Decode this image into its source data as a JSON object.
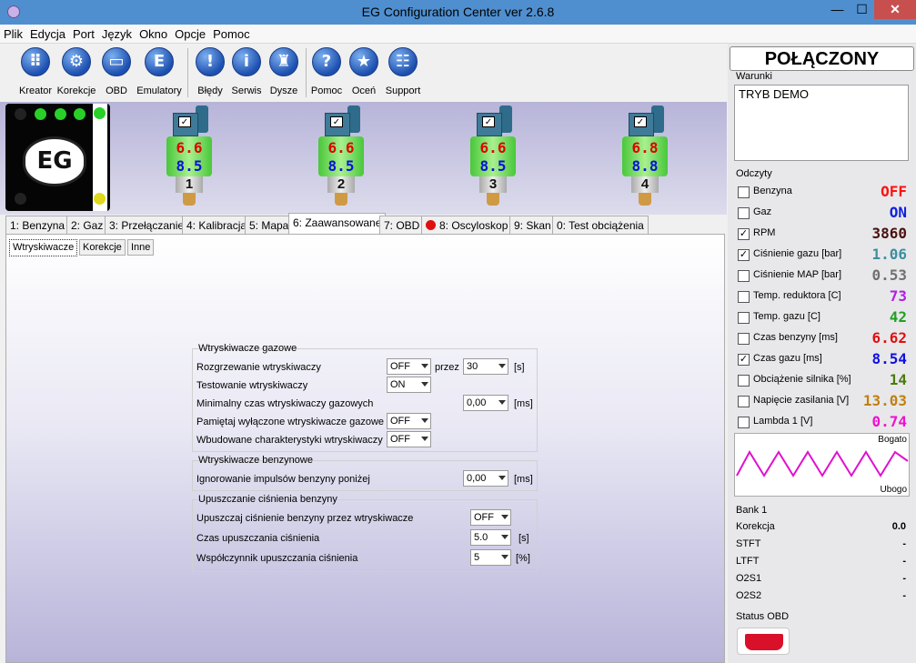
{
  "window": {
    "title": "EG Configuration Center ver 2.6.8",
    "minimize": "—",
    "maximize": "☐",
    "close": "✕"
  },
  "menu": [
    "Plik",
    "Edycja",
    "Port",
    "Język",
    "Okno",
    "Opcje",
    "Pomoc"
  ],
  "toolbar": [
    {
      "label": "Kreator",
      "icon": "grid-icon",
      "glyph": "⠿"
    },
    {
      "label": "Korekcje",
      "icon": "gear-icon",
      "glyph": "⚙"
    },
    {
      "label": "OBD",
      "icon": "obd-connector-icon",
      "glyph": "▭"
    },
    {
      "label": "Emulatory",
      "icon": "emulator-icon",
      "glyph": "E"
    },
    {
      "label": "Błędy",
      "icon": "error-icon",
      "glyph": "!"
    },
    {
      "label": "Serwis",
      "icon": "info-icon",
      "glyph": "i"
    },
    {
      "label": "Dysze",
      "icon": "nozzle-icon",
      "glyph": "♜"
    },
    {
      "label": "Pomoc",
      "icon": "help-icon",
      "glyph": "?"
    },
    {
      "label": "Oceń",
      "icon": "star-icon",
      "glyph": "★"
    },
    {
      "label": "Support",
      "icon": "support-icon",
      "glyph": "☷"
    }
  ],
  "logo": "EG",
  "injectors": [
    {
      "num": "1",
      "top": "6.6",
      "bottom": "8.5",
      "check": "✓"
    },
    {
      "num": "2",
      "top": "6.6",
      "bottom": "8.5",
      "check": "✓"
    },
    {
      "num": "3",
      "top": "6.6",
      "bottom": "8.5",
      "check": "✓"
    },
    {
      "num": "4",
      "top": "6.8",
      "bottom": "8.8",
      "check": "✓"
    }
  ],
  "tabs": [
    "1: Benzyna",
    "2: Gaz",
    "3: Przełączanie",
    "4: Kalibracja",
    "5: Mapa",
    "6: Zaawansowane",
    "7: OBD",
    "8: Oscyloskop",
    "9: Skan",
    "0: Test obciążenia"
  ],
  "subtabs": [
    "Wtryskiwacze",
    "Korekcje",
    "Inne"
  ],
  "groups": {
    "gas": {
      "title": "Wtryskiwacze gazowe",
      "rows": [
        {
          "label": "Rozgrzewanie wtryskiwaczy",
          "value": "OFF",
          "mid": "przez",
          "value2": "30",
          "unit": "[s]"
        },
        {
          "label": "Testowanie wtryskiwaczy",
          "value": "ON"
        },
        {
          "label": "Minimalny czas wtryskiwaczy gazowych",
          "value": "0,00",
          "unit": "[ms]"
        },
        {
          "label": "Pamiętaj wyłączone wtryskiwacze gazowe",
          "value": "OFF"
        },
        {
          "label": "Wbudowane charakterystyki wtryskiwaczy",
          "value": "OFF"
        }
      ]
    },
    "petrol": {
      "title": "Wtryskiwacze benzynowe",
      "rows": [
        {
          "label": "Ignorowanie impulsów benzyny poniżej",
          "value": "0,00",
          "unit": "[ms]"
        }
      ]
    },
    "release": {
      "title": "Upuszczanie ciśnienia benzyny",
      "rows": [
        {
          "label": "Upuszczaj ciśnienie benzyny przez wtryskiwacze",
          "value": "OFF"
        },
        {
          "label": "Czas upuszczania ciśnienia",
          "value": "5.0",
          "unit": "[s]"
        },
        {
          "label": "Współczynnik upuszczania ciśnienia",
          "value": "5",
          "unit": "[%]"
        }
      ]
    }
  },
  "status": "POŁĄCZONY",
  "warunki": {
    "title": "Warunki",
    "text": "TRYB DEMO"
  },
  "odczyty": {
    "title": "Odczyty",
    "items": [
      {
        "label": "Benzyna",
        "value": "OFF",
        "checked": false,
        "color": "#ff1010"
      },
      {
        "label": "Gaz",
        "value": "ON",
        "checked": false,
        "color": "#1020e0"
      },
      {
        "label": "RPM",
        "value": "3860",
        "checked": true,
        "color": "#4a1010"
      },
      {
        "label": "Ciśnienie gazu [bar]",
        "value": "1.06",
        "checked": true,
        "color": "#3b8fa0"
      },
      {
        "label": "Ciśnienie MAP [bar]",
        "value": "0.53",
        "checked": false,
        "color": "#707070"
      },
      {
        "label": "Temp. reduktora [C]",
        "value": "73",
        "checked": false,
        "color": "#b020e0"
      },
      {
        "label": "Temp. gazu [C]",
        "value": "42",
        "checked": false,
        "color": "#20a020"
      },
      {
        "label": "Czas benzyny [ms]",
        "value": "6.62",
        "checked": false,
        "color": "#e01010"
      },
      {
        "label": "Czas gazu [ms]",
        "value": "8.54",
        "checked": true,
        "color": "#1010e0"
      },
      {
        "label": "Obciążenie silnika [%]",
        "value": "14",
        "checked": false,
        "color": "#4a7a10"
      },
      {
        "label": "Napięcie zasilania [V]",
        "value": "13.03",
        "checked": false,
        "color": "#c08010"
      },
      {
        "label": "Lambda 1 [V]",
        "value": "0.74",
        "checked": false,
        "color": "#f010d0"
      }
    ]
  },
  "lambda": {
    "rich": "Bogato",
    "lean": "Ubogo"
  },
  "bank": {
    "title": "Bank 1",
    "rows": [
      {
        "label": "Korekcja",
        "value": "0.0"
      },
      {
        "label": "STFT",
        "value": "-"
      },
      {
        "label": "LTFT",
        "value": "-"
      },
      {
        "label": "O2S1",
        "value": "-"
      },
      {
        "label": "O2S2",
        "value": "-"
      }
    ]
  },
  "obd_status": {
    "title": "Status OBD",
    "icon": "obd-plug-icon"
  }
}
